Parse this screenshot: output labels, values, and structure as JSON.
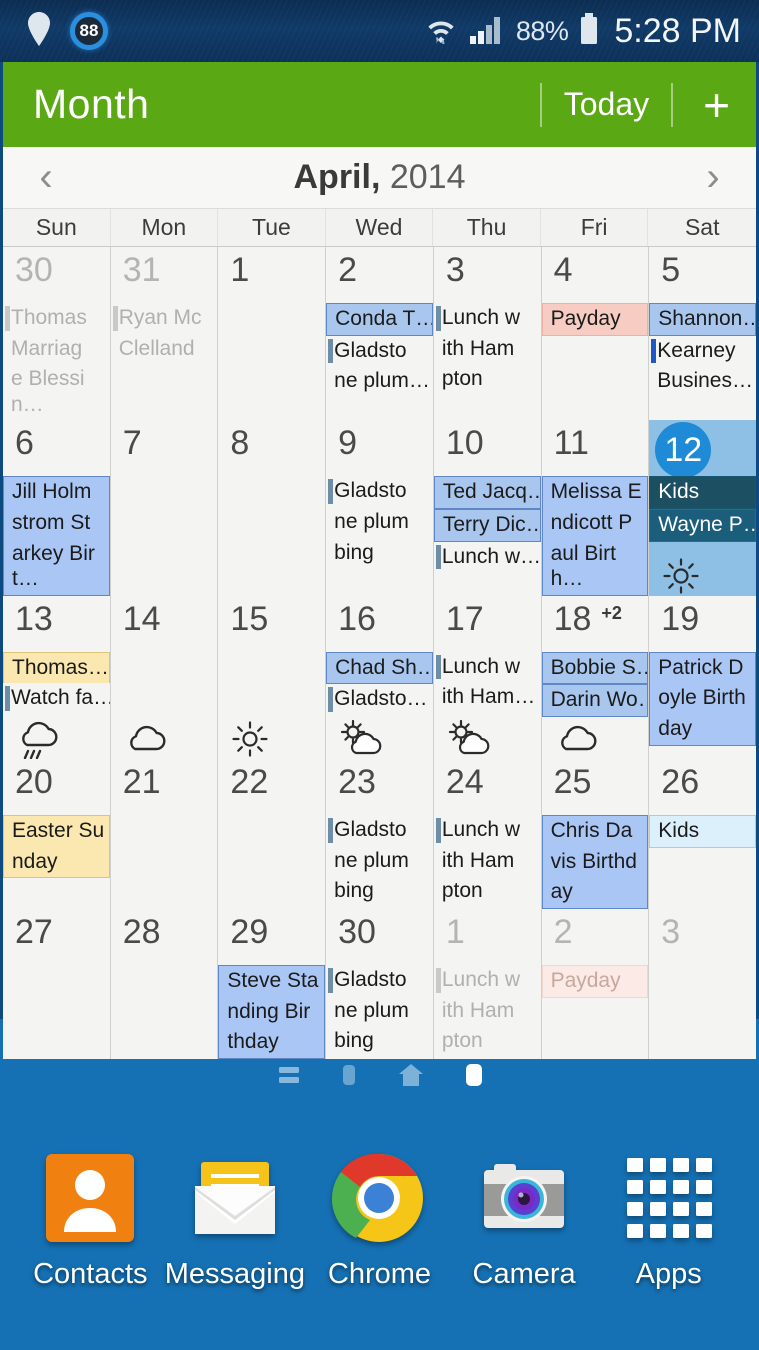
{
  "status_bar": {
    "location_icon": "location-pin-icon",
    "badge_value": "88",
    "wifi_icon": "wifi-icon",
    "signal_icon": "cellular-signal-icon",
    "battery_percent": "88%",
    "battery_icon": "battery-icon",
    "clock": "5:28 PM"
  },
  "action_bar": {
    "title": "Month",
    "today_label": "Today",
    "add_label": "+",
    "background_color": "#5aa814"
  },
  "month_nav": {
    "prev_icon": "chevron-left-icon",
    "next_icon": "chevron-right-icon",
    "month_name": "April,",
    "year": "2014"
  },
  "weekdays": [
    "Sun",
    "Mon",
    "Tue",
    "Wed",
    "Thu",
    "Fri",
    "Sat"
  ],
  "selected_day": "12",
  "weeks": [
    [
      {
        "day": "30",
        "other": true,
        "events": [
          {
            "text": "Thomas",
            "style": "bar"
          },
          {
            "text": "Marriag",
            "style": "plain"
          },
          {
            "text": "e Blessin…",
            "style": "plain"
          }
        ]
      },
      {
        "day": "31",
        "other": true,
        "events": [
          {
            "text": "Ryan Mc",
            "style": "bar"
          },
          {
            "text": "Clelland",
            "style": "plain"
          }
        ]
      },
      {
        "day": "1",
        "events": []
      },
      {
        "day": "2",
        "events": [
          {
            "text": "Conda T…",
            "style": "chip-blue"
          },
          {
            "text": "Gladsto",
            "style": "bar"
          },
          {
            "text": "ne plum…",
            "style": "plain"
          }
        ]
      },
      {
        "day": "3",
        "events": [
          {
            "text": "Lunch w",
            "style": "bar"
          },
          {
            "text": "ith Ham",
            "style": "plain"
          },
          {
            "text": "pton",
            "style": "plain"
          }
        ]
      },
      {
        "day": "4",
        "events": [
          {
            "text": "Payday",
            "style": "chip-pink"
          }
        ]
      },
      {
        "day": "5",
        "events": [
          {
            "text": "Shannon…",
            "style": "chip-blue"
          },
          {
            "text": "Kearney",
            "style": "bar-blue"
          },
          {
            "text": "Busines…",
            "style": "plain"
          }
        ]
      }
    ],
    [
      {
        "day": "6",
        "events": [
          {
            "text": "Jill Holm",
            "style": "chip-blue-solid"
          },
          {
            "text": "strom St",
            "style": "chip-blue-solid-cont"
          },
          {
            "text": "arkey Birt…",
            "style": "chip-blue-solid-cont"
          }
        ]
      },
      {
        "day": "7",
        "events": []
      },
      {
        "day": "8",
        "events": []
      },
      {
        "day": "9",
        "events": [
          {
            "text": "Gladsto",
            "style": "bar"
          },
          {
            "text": "ne plum",
            "style": "plain"
          },
          {
            "text": "bing",
            "style": "plain"
          }
        ]
      },
      {
        "day": "10",
        "events": [
          {
            "text": "Ted Jacq…",
            "style": "chip-blue"
          },
          {
            "text": "Terry Dic…",
            "style": "chip-blue"
          },
          {
            "text": "Lunch w…",
            "style": "bar"
          }
        ]
      },
      {
        "day": "11",
        "events": [
          {
            "text": "Melissa E",
            "style": "chip-blue-solid"
          },
          {
            "text": "ndicott P",
            "style": "chip-blue-solid-cont"
          },
          {
            "text": "aul Birth…",
            "style": "chip-blue-solid-cont"
          }
        ]
      },
      {
        "day": "12",
        "selected": true,
        "weather": "sunny",
        "events": [
          {
            "text": "Kids",
            "style": "chip-dark"
          },
          {
            "text": "Wayne P…",
            "style": "chip-dark2"
          }
        ]
      }
    ],
    [
      {
        "day": "13",
        "weather": "rain",
        "events": [
          {
            "text": "Thomas…",
            "style": "chip-yellow"
          },
          {
            "text": "Watch fa…",
            "style": "bar"
          }
        ]
      },
      {
        "day": "14",
        "weather": "cloudy",
        "events": []
      },
      {
        "day": "15",
        "weather": "sunny",
        "events": []
      },
      {
        "day": "16",
        "weather": "partly",
        "events": [
          {
            "text": "Chad Sh…",
            "style": "chip-blue"
          },
          {
            "text": "Gladsto…",
            "style": "bar"
          }
        ]
      },
      {
        "day": "17",
        "weather": "partly",
        "events": [
          {
            "text": "Lunch w",
            "style": "bar"
          },
          {
            "text": "ith Ham…",
            "style": "plain"
          }
        ]
      },
      {
        "day": "18",
        "more": "+2",
        "weather": "cloudy",
        "events": [
          {
            "text": "Bobbie S…",
            "style": "chip-blue"
          },
          {
            "text": "Darin Wo…",
            "style": "chip-blue"
          }
        ]
      },
      {
        "day": "19",
        "events": [
          {
            "text": "Patrick D",
            "style": "chip-blue-solid"
          },
          {
            "text": "oyle Birth",
            "style": "chip-blue-solid-cont"
          },
          {
            "text": "day",
            "style": "chip-blue-solid-cont"
          }
        ]
      }
    ],
    [
      {
        "day": "20",
        "events": [
          {
            "text": "Easter Su",
            "style": "chip-yellow"
          },
          {
            "text": "nday",
            "style": "chip-yellow-cont"
          }
        ]
      },
      {
        "day": "21",
        "events": []
      },
      {
        "day": "22",
        "events": []
      },
      {
        "day": "23",
        "events": [
          {
            "text": "Gladsto",
            "style": "bar"
          },
          {
            "text": "ne plum",
            "style": "plain"
          },
          {
            "text": "bing",
            "style": "plain"
          }
        ]
      },
      {
        "day": "24",
        "events": [
          {
            "text": "Lunch w",
            "style": "bar"
          },
          {
            "text": "ith Ham",
            "style": "plain"
          },
          {
            "text": "pton",
            "style": "plain"
          }
        ]
      },
      {
        "day": "25",
        "events": [
          {
            "text": "Chris Da",
            "style": "chip-blue-solid"
          },
          {
            "text": "vis Birthd",
            "style": "chip-blue-solid-cont"
          },
          {
            "text": "ay",
            "style": "chip-blue-solid-cont"
          }
        ]
      },
      {
        "day": "26",
        "events": [
          {
            "text": "Kids",
            "style": "chip-cyan"
          }
        ]
      }
    ],
    [
      {
        "day": "27",
        "events": []
      },
      {
        "day": "28",
        "events": []
      },
      {
        "day": "29",
        "events": [
          {
            "text": "Steve Sta",
            "style": "chip-blue-solid"
          },
          {
            "text": "nding Bir",
            "style": "chip-blue-solid-cont"
          },
          {
            "text": "thday",
            "style": "chip-blue-solid-cont"
          }
        ]
      },
      {
        "day": "30",
        "events": [
          {
            "text": "Gladsto",
            "style": "bar"
          },
          {
            "text": "ne plum",
            "style": "plain"
          },
          {
            "text": "bing",
            "style": "plain"
          }
        ]
      },
      {
        "day": "1",
        "other": true,
        "events": [
          {
            "text": "Lunch w",
            "style": "bar"
          },
          {
            "text": "ith Ham",
            "style": "plain"
          },
          {
            "text": "pton",
            "style": "plain"
          }
        ]
      },
      {
        "day": "2",
        "other": true,
        "events": [
          {
            "text": "Payday",
            "style": "chip-pink"
          }
        ]
      },
      {
        "day": "3",
        "other": true,
        "events": []
      }
    ]
  ],
  "page_indicators": [
    {
      "icon": "list-page-icon",
      "active": false
    },
    {
      "icon": "square-page-icon",
      "active": false
    },
    {
      "icon": "home-page-icon",
      "active": false
    },
    {
      "icon": "current-page-icon",
      "active": true
    }
  ],
  "dock": [
    {
      "label": "Contacts",
      "icon": "contacts-icon"
    },
    {
      "label": "Messaging",
      "icon": "messaging-icon"
    },
    {
      "label": "Chrome",
      "icon": "chrome-icon"
    },
    {
      "label": "Camera",
      "icon": "camera-icon"
    },
    {
      "label": "Apps",
      "icon": "apps-grid-icon"
    }
  ],
  "colors": {
    "action_bar_green": "#5aa814",
    "selected_blue": "#1f8ad6",
    "selection_bg": "#8dc0e4",
    "event_blue": "#a9c7ee",
    "event_pink": "#f7cdc3",
    "event_yellow": "#fbe8b0",
    "wallpaper_blue": "#1571b4"
  }
}
